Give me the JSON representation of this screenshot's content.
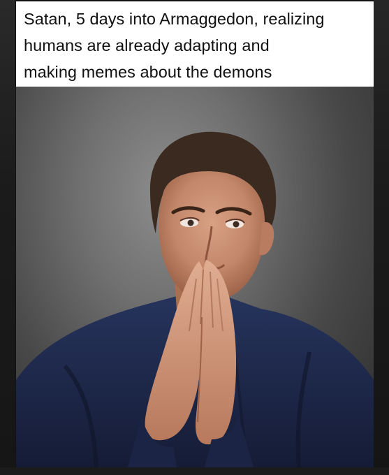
{
  "caption": {
    "lines": [
      "Satan, 5 days into Armaggedon, realizing",
      "humans are already adapting and",
      "making memes about the demons"
    ]
  },
  "photo": {
    "subject": "man-with-hands-clasped-over-mouth"
  },
  "colors": {
    "caption_background": "#ffffff",
    "caption_text": "#111111",
    "frame": "#1b1b1b",
    "backdrop": "#6f6f6f",
    "jacket": "#1f2a4e"
  }
}
